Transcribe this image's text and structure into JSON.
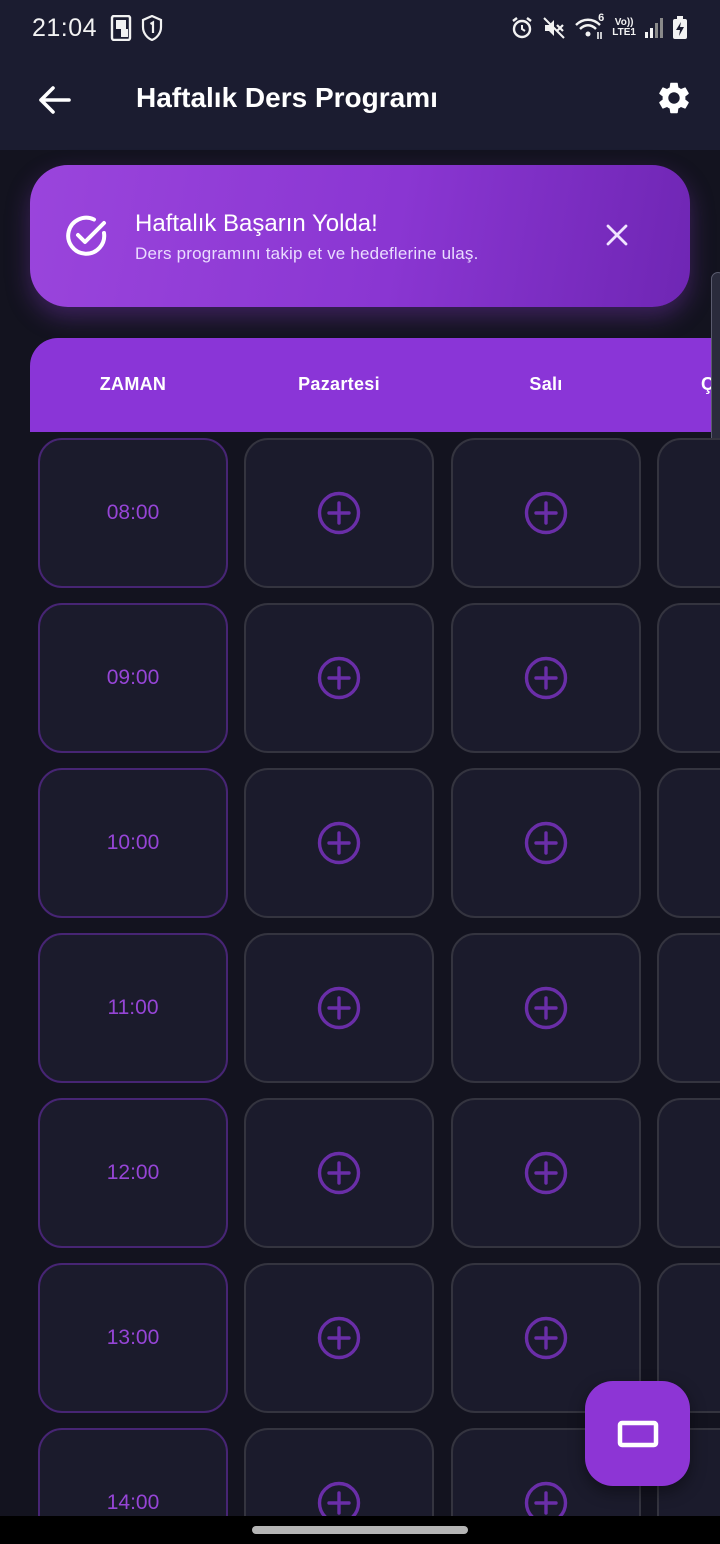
{
  "status_bar": {
    "time": "21:04",
    "left_icons": [
      "sim-icon",
      "shield-one-icon"
    ],
    "right_icons": [
      "alarm-icon",
      "mute-icon",
      "wifi-icon",
      "network-label",
      "signal-icon",
      "battery-charging-icon"
    ],
    "network_line1": "Vo))",
    "network_line2": "LTE1",
    "wifi_badge": "6"
  },
  "app_bar": {
    "title": "Haftalık Ders Programı",
    "back_icon": "arrow-left-icon",
    "settings_icon": "gear-icon"
  },
  "banner": {
    "title": "Haftalık Başarın Yolda!",
    "subtitle": "Ders programını takip et ve hedeflerine ulaş.",
    "check_icon": "check-circle-icon",
    "close_icon": "close-icon"
  },
  "table": {
    "columns": [
      "ZAMAN",
      "Pazartesi",
      "Salı",
      "Ça"
    ],
    "times": [
      "08:00",
      "09:00",
      "10:00",
      "11:00",
      "12:00",
      "13:00",
      "14:00"
    ],
    "slot_icon": "plus-circle-icon"
  },
  "fab": {
    "icon": "rectangle-icon"
  },
  "colors": {
    "accent": "#8a35d7",
    "background": "#13131f",
    "surface": "#1b1b2c",
    "time_text": "#9645d6"
  }
}
